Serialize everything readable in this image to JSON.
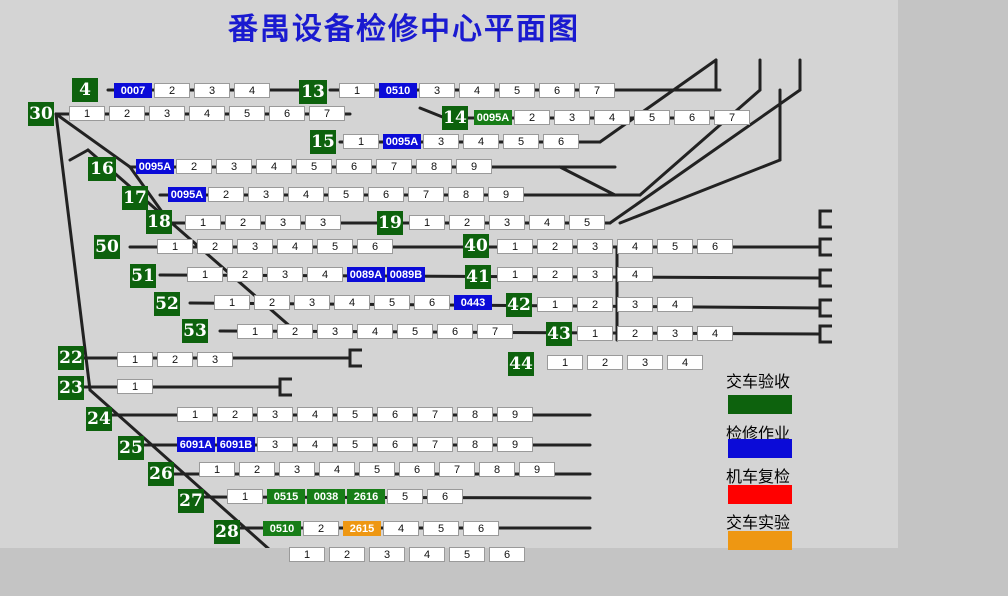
{
  "title": "番禺设备检修中心平面图",
  "colors": {
    "label_bg": "#0d620d",
    "status_acceptance": "#0d620d",
    "status_repair": "#0b0bd8",
    "status_recheck": "#ff0000",
    "status_test": "#ee9712",
    "title": "#1a1ad0"
  },
  "tracks": [
    {
      "label": "4",
      "cells": [
        {
          "t": "0007",
          "s": "blue"
        },
        {
          "t": "2"
        },
        {
          "t": "3"
        },
        {
          "t": "4"
        }
      ]
    },
    {
      "label": "13",
      "cells": [
        {
          "t": "1"
        },
        {
          "t": "0510",
          "s": "blue"
        },
        {
          "t": "3"
        },
        {
          "t": "4"
        },
        {
          "t": "5"
        },
        {
          "t": "6"
        },
        {
          "t": "7"
        }
      ]
    },
    {
      "label": "30",
      "cells": [
        {
          "t": "1"
        },
        {
          "t": "2"
        },
        {
          "t": "3"
        },
        {
          "t": "4"
        },
        {
          "t": "5"
        },
        {
          "t": "6"
        },
        {
          "t": "7"
        }
      ]
    },
    {
      "label": "14",
      "cells": [
        {
          "t": "0095A",
          "s": "green"
        },
        {
          "t": "2"
        },
        {
          "t": "3"
        },
        {
          "t": "4"
        },
        {
          "t": "5"
        },
        {
          "t": "6"
        },
        {
          "t": "7"
        }
      ]
    },
    {
      "label": "15",
      "cells": [
        {
          "t": "1"
        },
        {
          "t": "0095A",
          "s": "blue"
        },
        {
          "t": "3"
        },
        {
          "t": "4"
        },
        {
          "t": "5"
        },
        {
          "t": "6"
        }
      ]
    },
    {
      "label": "16",
      "cells": [
        {
          "t": "0095A",
          "s": "blue"
        },
        {
          "t": "2"
        },
        {
          "t": "3"
        },
        {
          "t": "4"
        },
        {
          "t": "5"
        },
        {
          "t": "6"
        },
        {
          "t": "7"
        },
        {
          "t": "8"
        },
        {
          "t": "9"
        }
      ]
    },
    {
      "label": "17",
      "cells": [
        {
          "t": "0095A",
          "s": "blue"
        },
        {
          "t": "2"
        },
        {
          "t": "3"
        },
        {
          "t": "4"
        },
        {
          "t": "5"
        },
        {
          "t": "6"
        },
        {
          "t": "7"
        },
        {
          "t": "8"
        },
        {
          "t": "9"
        }
      ]
    },
    {
      "label": "18",
      "cells": [
        {
          "t": "1"
        },
        {
          "t": "2"
        },
        {
          "t": "3"
        },
        {
          "t": "3"
        }
      ]
    },
    {
      "label": "19",
      "cells": [
        {
          "t": "1"
        },
        {
          "t": "2"
        },
        {
          "t": "3"
        },
        {
          "t": "4"
        },
        {
          "t": "5"
        }
      ]
    },
    {
      "label": "50",
      "cells": [
        {
          "t": "1"
        },
        {
          "t": "2"
        },
        {
          "t": "3"
        },
        {
          "t": "4"
        },
        {
          "t": "5"
        },
        {
          "t": "6"
        }
      ]
    },
    {
      "label": "40",
      "cells": [
        {
          "t": "1"
        },
        {
          "t": "2"
        },
        {
          "t": "3"
        },
        {
          "t": "4"
        },
        {
          "t": "5"
        },
        {
          "t": "6"
        }
      ]
    },
    {
      "label": "51",
      "cells": [
        {
          "t": "1"
        },
        {
          "t": "2"
        },
        {
          "t": "3"
        },
        {
          "t": "4"
        },
        {
          "t": "0089A",
          "s": "blue"
        },
        {
          "t": "0089B",
          "s": "blue"
        }
      ]
    },
    {
      "label": "41",
      "cells": [
        {
          "t": "1"
        },
        {
          "t": "2"
        },
        {
          "t": "3"
        },
        {
          "t": "4"
        }
      ]
    },
    {
      "label": "52",
      "cells": [
        {
          "t": "1"
        },
        {
          "t": "2"
        },
        {
          "t": "3"
        },
        {
          "t": "4"
        },
        {
          "t": "5"
        },
        {
          "t": "6"
        },
        {
          "t": "0443",
          "s": "blue"
        }
      ]
    },
    {
      "label": "42",
      "cells": [
        {
          "t": "1"
        },
        {
          "t": "2"
        },
        {
          "t": "3"
        },
        {
          "t": "4"
        }
      ]
    },
    {
      "label": "53",
      "cells": [
        {
          "t": "1"
        },
        {
          "t": "2"
        },
        {
          "t": "3"
        },
        {
          "t": "4"
        },
        {
          "t": "5"
        },
        {
          "t": "6"
        },
        {
          "t": "7"
        }
      ]
    },
    {
      "label": "43",
      "cells": [
        {
          "t": "1"
        },
        {
          "t": "2"
        },
        {
          "t": "3"
        },
        {
          "t": "4"
        }
      ]
    },
    {
      "label": "44",
      "cells": [
        {
          "t": "1"
        },
        {
          "t": "2"
        },
        {
          "t": "3"
        },
        {
          "t": "4"
        }
      ]
    },
    {
      "label": "22",
      "cells": [
        {
          "t": "1"
        },
        {
          "t": "2"
        },
        {
          "t": "3"
        }
      ]
    },
    {
      "label": "23",
      "cells": [
        {
          "t": "1"
        }
      ]
    },
    {
      "label": "24",
      "cells": [
        {
          "t": "1"
        },
        {
          "t": "2"
        },
        {
          "t": "3"
        },
        {
          "t": "4"
        },
        {
          "t": "5"
        },
        {
          "t": "6"
        },
        {
          "t": "7"
        },
        {
          "t": "8"
        },
        {
          "t": "9"
        }
      ]
    },
    {
      "label": "25",
      "cells": [
        {
          "t": "6091A",
          "s": "blue"
        },
        {
          "t": "6091B",
          "s": "blue"
        },
        {
          "t": "3"
        },
        {
          "t": "4"
        },
        {
          "t": "5"
        },
        {
          "t": "6"
        },
        {
          "t": "7"
        },
        {
          "t": "8"
        },
        {
          "t": "9"
        }
      ]
    },
    {
      "label": "26",
      "cells": [
        {
          "t": "1"
        },
        {
          "t": "2"
        },
        {
          "t": "3"
        },
        {
          "t": "4"
        },
        {
          "t": "5"
        },
        {
          "t": "6"
        },
        {
          "t": "7"
        },
        {
          "t": "8"
        },
        {
          "t": "9"
        }
      ]
    },
    {
      "label": "27",
      "cells": [
        {
          "t": "1"
        },
        {
          "t": "0515",
          "s": "green"
        },
        {
          "t": "0038",
          "s": "green"
        },
        {
          "t": "2616",
          "s": "green"
        },
        {
          "t": "5"
        },
        {
          "t": "6"
        }
      ]
    },
    {
      "label": "28",
      "cells": [
        {
          "t": "0510",
          "s": "green"
        },
        {
          "t": "2"
        },
        {
          "t": "2615",
          "s": "orange"
        },
        {
          "t": "4"
        },
        {
          "t": "5"
        },
        {
          "t": "6"
        }
      ]
    },
    {
      "label": "",
      "cells": [
        {
          "t": "1"
        },
        {
          "t": "2"
        },
        {
          "t": "3"
        },
        {
          "t": "4"
        },
        {
          "t": "5"
        },
        {
          "t": "6"
        }
      ]
    }
  ],
  "legend": [
    {
      "label": "交车验收",
      "color": "#0d620d"
    },
    {
      "label": "检修作业",
      "color": "#0b0bd8"
    },
    {
      "label": "机车复检",
      "color": "#ff0000"
    },
    {
      "label": "交车实验",
      "color": "#ee9712"
    }
  ]
}
